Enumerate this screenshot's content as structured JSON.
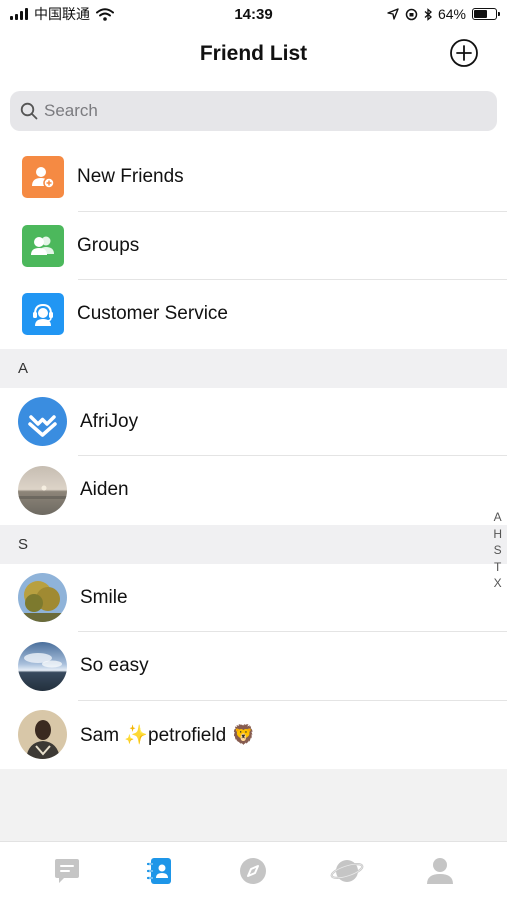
{
  "status_bar": {
    "carrier": "中国联通",
    "time": "14:39",
    "battery_percent_text": "64%",
    "battery_level": 0.64
  },
  "header": {
    "title": "Friend List",
    "add_icon": "plus-circle-icon"
  },
  "search": {
    "placeholder": "Search"
  },
  "menu_items": [
    {
      "label": "New Friends",
      "icon": "add-friend-icon",
      "color": "#f58a43"
    },
    {
      "label": "Groups",
      "icon": "group-icon",
      "color": "#4cb85c"
    },
    {
      "label": "Customer Service",
      "icon": "headset-icon",
      "color": "#2196f3"
    }
  ],
  "sections": [
    {
      "letter": "A",
      "contacts": [
        {
          "name": "AfriJoy",
          "avatar": "afrijoy-logo"
        },
        {
          "name": "Aiden",
          "avatar": "sunset-sea-photo"
        }
      ]
    },
    {
      "letter": "S",
      "contacts": [
        {
          "name": "Smile",
          "avatar": "autumn-tree-photo"
        },
        {
          "name": "So easy",
          "avatar": "lake-sky-photo"
        },
        {
          "name": "Sam ✨petrofield 🦁",
          "avatar": "person-portrait-photo"
        }
      ]
    }
  ],
  "index_letters": [
    "A",
    "H",
    "S",
    "T",
    "X"
  ],
  "tabs": [
    {
      "icon": "chat-icon",
      "active": false
    },
    {
      "icon": "contacts-icon",
      "active": true
    },
    {
      "icon": "discover-compass-icon",
      "active": false
    },
    {
      "icon": "planet-icon",
      "active": false
    },
    {
      "icon": "profile-icon",
      "active": false
    }
  ],
  "colors": {
    "accent": "#1e96e8",
    "tab_inactive": "#c5c5c5"
  }
}
